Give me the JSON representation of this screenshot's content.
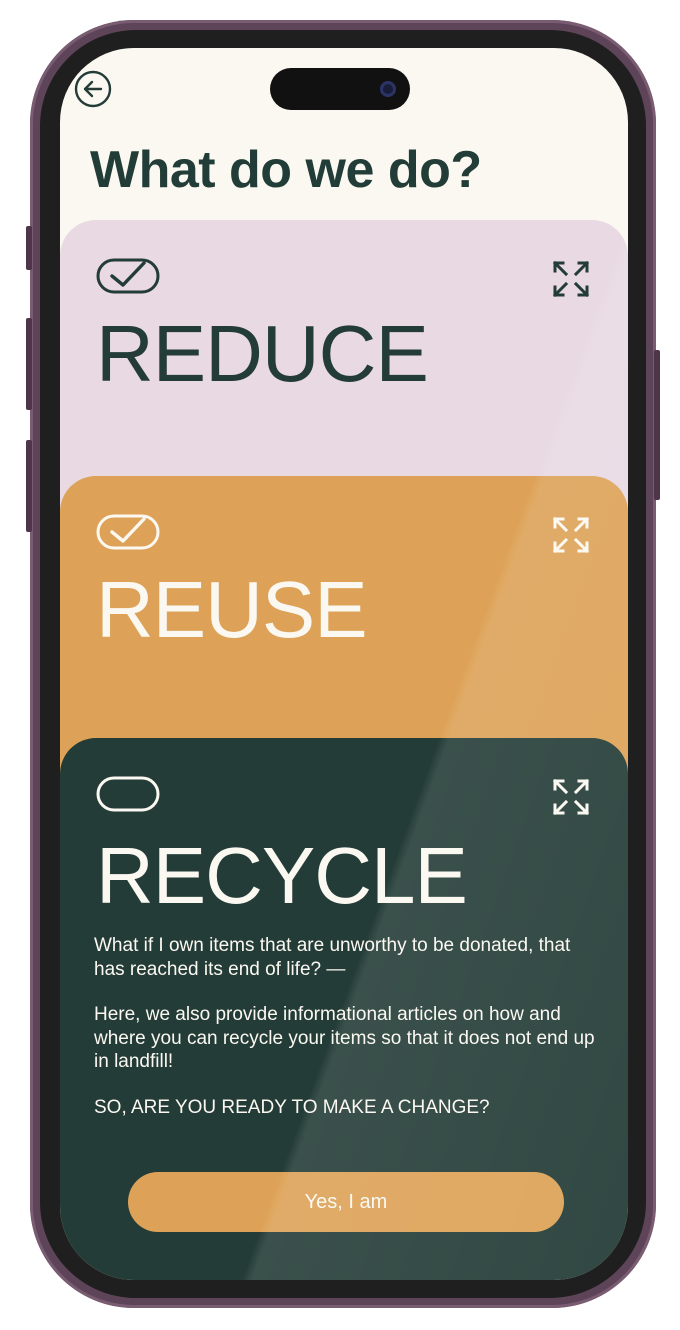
{
  "header": {
    "title": "What do we do?"
  },
  "cards": [
    {
      "title": "REDUCE",
      "checked": true
    },
    {
      "title": "REUSE",
      "checked": true
    },
    {
      "title": "RECYCLE",
      "checked": false,
      "paragraphs": [
        "What if I own items that are unworthy to be donated, that has reached its end of life? —",
        "Here, we also provide informational articles on how and where you can recycle your items so that it does not end up in landfill!",
        "SO, ARE YOU READY TO MAKE A CHANGE?"
      ],
      "button_label": "Yes, I am"
    }
  ],
  "icons": {
    "back": "arrow-left-circle-icon",
    "check": "check-pill-icon",
    "empty": "empty-pill-icon",
    "expand": "expand-arrows-icon"
  },
  "colors": {
    "background": "#fbf8f1",
    "dark_green": "#243c37",
    "pink": "#e8d9e3",
    "orange": "#dda257",
    "cream_text": "#fbf8f1"
  }
}
